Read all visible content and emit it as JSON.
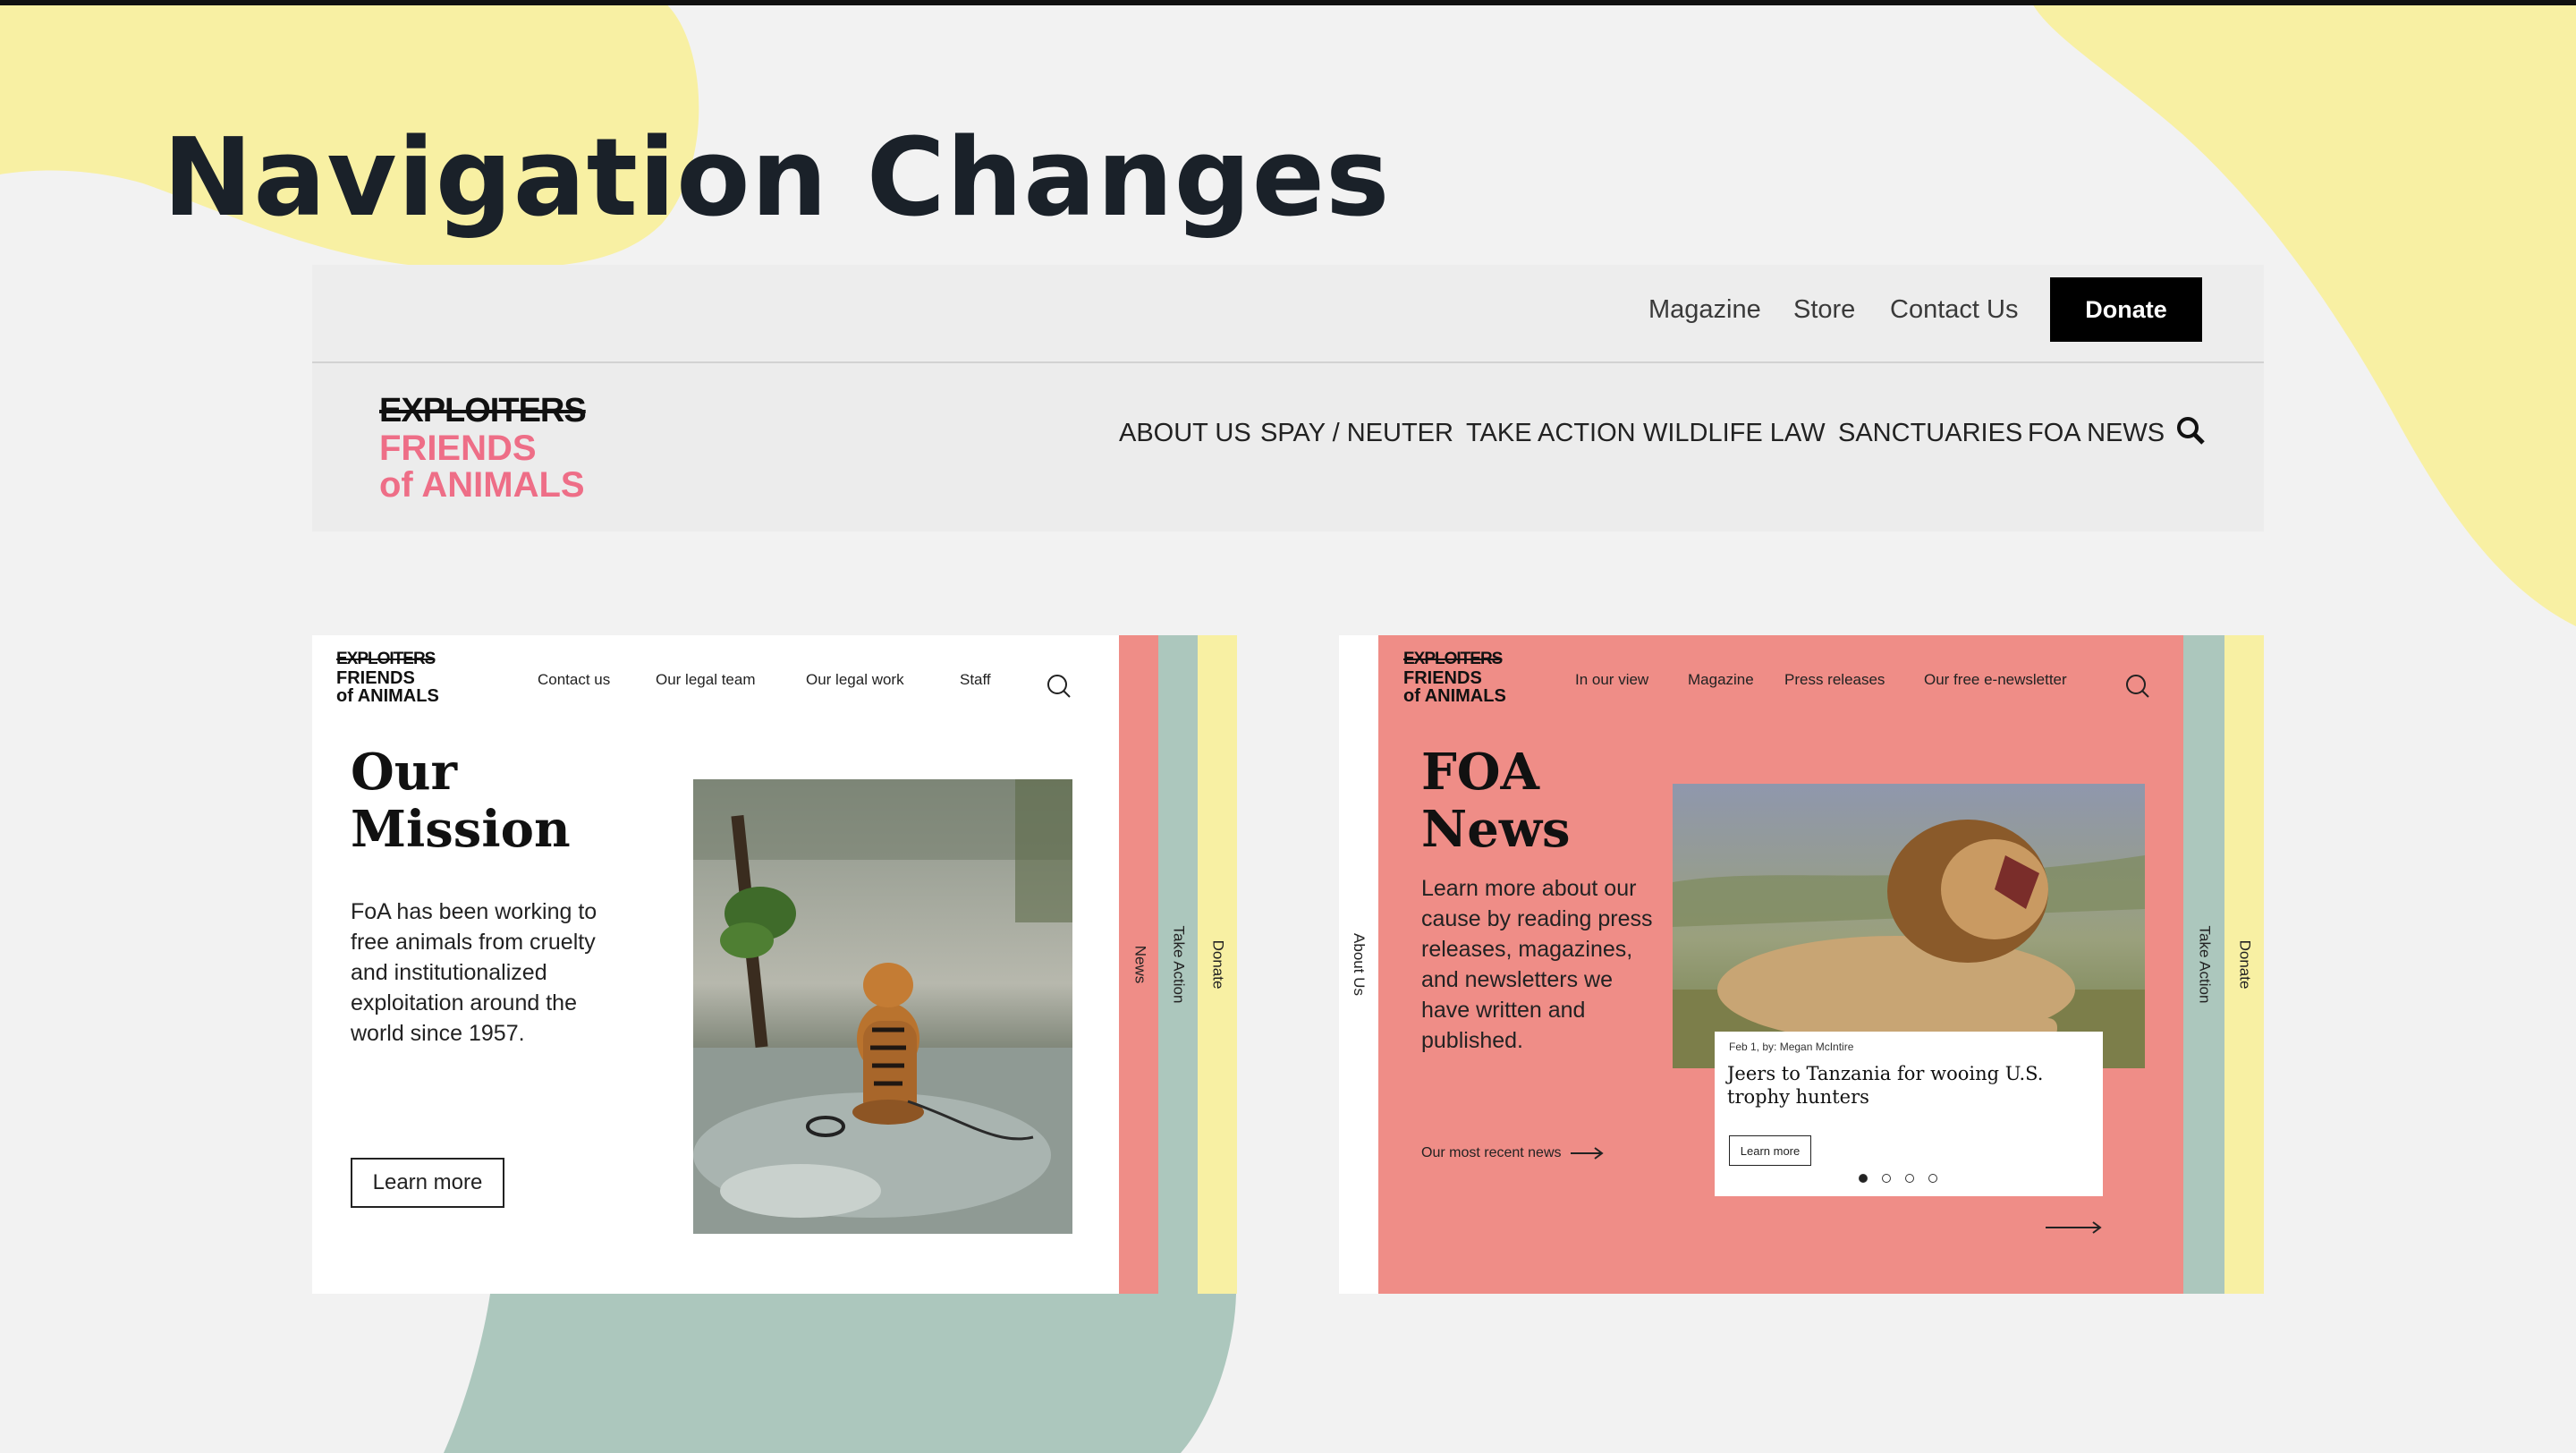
{
  "slide": {
    "title": "Navigation Changes"
  },
  "old_site": {
    "utility_nav": [
      "Magazine",
      "Store",
      "Contact Us"
    ],
    "donate_label": "Donate",
    "logo": {
      "strike": "EXPLOITERS",
      "line1": "FRIENDS",
      "line2": "of ANIMALS"
    },
    "main_nav": [
      "ABOUT US",
      "SPAY / NEUTER",
      "TAKE ACTION",
      "WILDLIFE LAW",
      "SANCTUARIES",
      "FOA NEWS"
    ],
    "search_icon": "search-icon"
  },
  "mission_page": {
    "logo": {
      "strike": "EXPLOITERS",
      "line1": "FRIENDS",
      "line2": "of ANIMALS"
    },
    "nav": [
      "Contact us",
      "Our legal team",
      "Our legal work",
      "Staff"
    ],
    "heading": [
      "Our",
      "Mission"
    ],
    "body": "FoA has been working to free animals from cruelty and institutionalized exploitation around the world since 1957.",
    "button": "Learn more",
    "image": "tiger-cub-photo",
    "tabs": [
      "News",
      "Take Action",
      "Donate"
    ]
  },
  "news_page": {
    "logo": {
      "strike": "EXPLOITERS",
      "line1": "FRIENDS",
      "line2": "of ANIMALS"
    },
    "nav": [
      "In our view",
      "Magazine",
      "Press releases",
      "Our free e-newsletter"
    ],
    "left_tab": "About Us",
    "heading": [
      "FOA",
      "News"
    ],
    "body": "Learn more about our cause by reading press releases, magazines, and newsletters we have written and published.",
    "recent_link": "Our most recent news",
    "card": {
      "meta": "Feb 1, by: Megan McIntire",
      "title": "Jeers to Tanzania for wooing U.S. trophy hunters",
      "button": "Learn more"
    },
    "image": "lion-photo",
    "tabs": [
      "Take Action",
      "Donate"
    ]
  },
  "colors": {
    "yellow": "#f8f0a3",
    "sage": "#acc7bd",
    "coral": "#ef8d87",
    "pink": "#ee6e87",
    "title": "#1a2129"
  }
}
